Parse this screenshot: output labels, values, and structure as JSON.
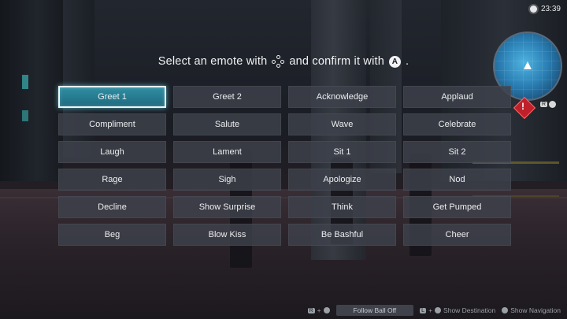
{
  "clock": {
    "time": "23:39"
  },
  "prompt": {
    "text_before": "Select an emote with",
    "text_middle": "and confirm it with",
    "text_after": ".",
    "confirm_button": "A"
  },
  "emotes": [
    {
      "label": "Greet 1",
      "selected": true
    },
    {
      "label": "Greet 2"
    },
    {
      "label": "Acknowledge"
    },
    {
      "label": "Applaud"
    },
    {
      "label": "Compliment"
    },
    {
      "label": "Salute"
    },
    {
      "label": "Wave"
    },
    {
      "label": "Celebrate"
    },
    {
      "label": "Laugh"
    },
    {
      "label": "Lament"
    },
    {
      "label": "Sit 1"
    },
    {
      "label": "Sit 2"
    },
    {
      "label": "Rage"
    },
    {
      "label": "Sigh"
    },
    {
      "label": "Apologize"
    },
    {
      "label": "Nod"
    },
    {
      "label": "Decline"
    },
    {
      "label": "Show Surprise"
    },
    {
      "label": "Think"
    },
    {
      "label": "Get Pumped"
    },
    {
      "label": "Beg"
    },
    {
      "label": "Blow Kiss"
    },
    {
      "label": "Be Bashful"
    },
    {
      "label": "Cheer"
    }
  ],
  "minimap": {
    "hint_key": "R"
  },
  "bottom_bar": {
    "follow_key": "R",
    "follow_plus": "+",
    "follow_label": "Follow Ball Off",
    "destination_key": "L",
    "destination_plus": "+",
    "destination_label": "Show Destination",
    "navigation_label": "Show Navigation"
  },
  "colors": {
    "selected": "#2a8299",
    "button": "#3e424c",
    "text": "#eceef0"
  }
}
